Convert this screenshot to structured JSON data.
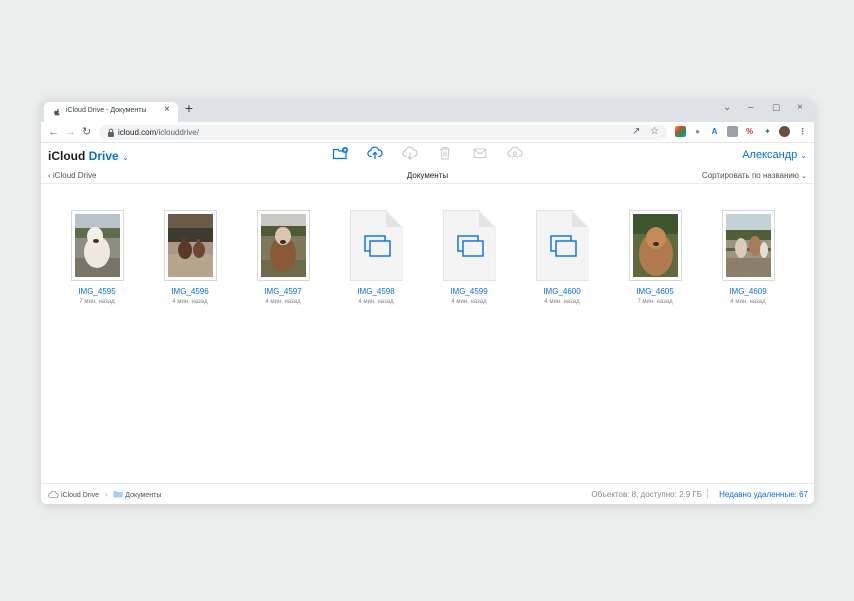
{
  "browser": {
    "tab_title": "iCloud Drive - Документы",
    "tab_close_glyph": "×",
    "new_tab_glyph": "+",
    "url_host": "icloud.com",
    "url_path": "/iclouddrive/",
    "window_controls": {
      "minimize": "–",
      "restore": "☐",
      "close": "×",
      "tab_search": "⌄"
    }
  },
  "app": {
    "brand": "iCloud",
    "product": "Drive",
    "chevron": "⌄",
    "user_name": "Александр"
  },
  "nav": {
    "back_label": "iCloud Drive",
    "folder_title": "Документы",
    "sort_label": "Сортировать по названию"
  },
  "files": [
    {
      "name": "IMG_4595",
      "time": "7 мин. назад",
      "kind": "photo",
      "scene": "white alpaca"
    },
    {
      "name": "IMG_4596",
      "time": "4 мин. назад",
      "kind": "photo",
      "scene": "alpacas in pen"
    },
    {
      "name": "IMG_4597",
      "time": "4 мин. назад",
      "kind": "photo",
      "scene": "brown alpaca"
    },
    {
      "name": "IMG_4598",
      "time": "4 мин. назад",
      "kind": "document"
    },
    {
      "name": "IMG_4599",
      "time": "4 мин. назад",
      "kind": "document"
    },
    {
      "name": "IMG_4600",
      "time": "4 мин. назад",
      "kind": "document"
    },
    {
      "name": "IMG_4605",
      "time": "7 мин. назад",
      "kind": "photo",
      "scene": "fluffy alpaca"
    },
    {
      "name": "IMG_4609",
      "time": "4 мин. назад",
      "kind": "photo",
      "scene": "alpacas at fence"
    }
  ],
  "footer": {
    "root_crumb": "iCloud Drive",
    "crumb_separator": "›",
    "folder_crumb": "Документы",
    "stats": "Объектов: 8, доступно: 2.9 ГБ",
    "recently_deleted": "Недавно удаленные: 67"
  },
  "colors": {
    "accent": "#0071e3",
    "tabstrip": "#dee1e6",
    "page_bg": "#eceeee"
  }
}
